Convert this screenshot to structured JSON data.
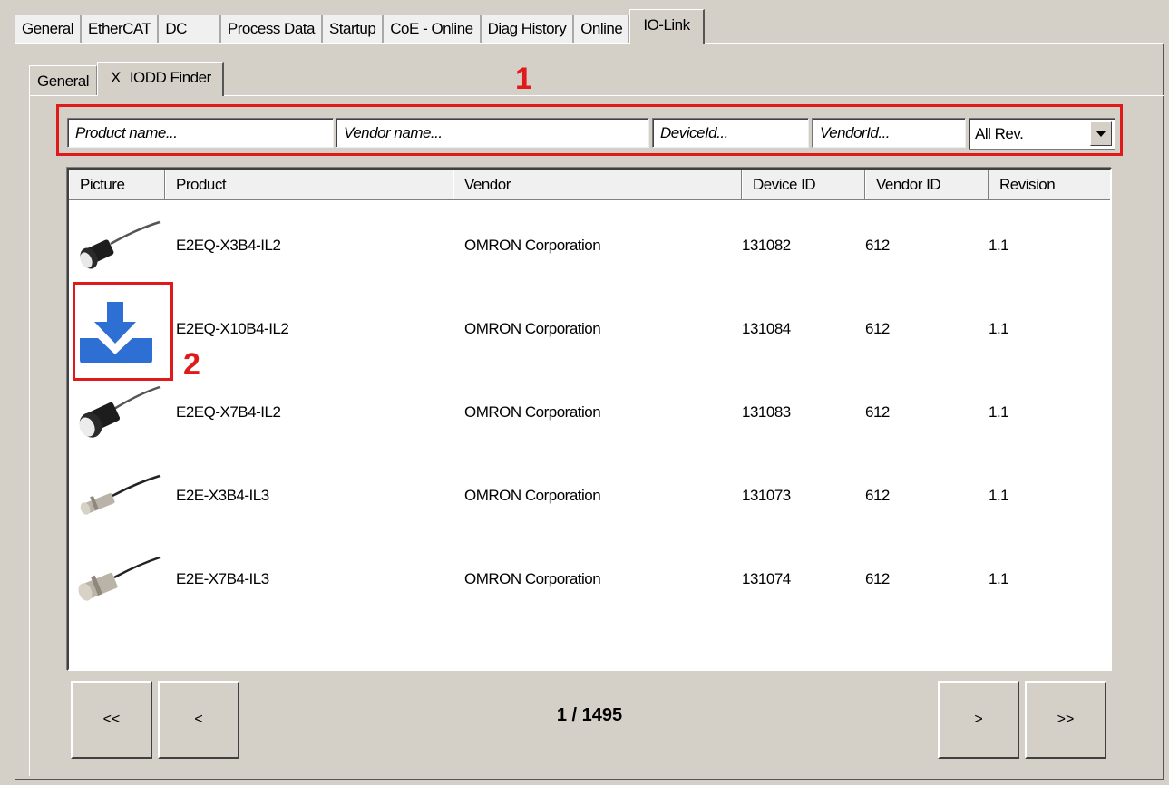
{
  "outer_tabs": [
    "General",
    "EtherCAT",
    "DC",
    "Process Data",
    "Startup",
    "CoE - Online",
    "Diag History",
    "Online",
    "IO-Link"
  ],
  "inner_tabs": {
    "general": "General",
    "close_glyph": "X",
    "iodd_finder": "IODD Finder"
  },
  "callouts": {
    "filter": "1",
    "download": "2"
  },
  "filters": {
    "product_placeholder": "Product name...",
    "vendor_placeholder": "Vendor name...",
    "device_placeholder": "DeviceId...",
    "vendorid_placeholder": "VendorId...",
    "revision_selected": "All Rev."
  },
  "columns": [
    "Picture",
    "Product",
    "Vendor",
    "Device ID",
    "Vendor ID",
    "Revision"
  ],
  "rows": [
    {
      "picture": "sensor-black-icon",
      "product": "E2EQ-X3B4-IL2",
      "vendor": "OMRON Corporation",
      "device_id": "131082",
      "vendor_id": "612",
      "revision": "1.1"
    },
    {
      "picture": "download-icon",
      "product": "E2EQ-X10B4-IL2",
      "vendor": "OMRON Corporation",
      "device_id": "131084",
      "vendor_id": "612",
      "revision": "1.1"
    },
    {
      "picture": "sensor-black-icon",
      "product": "E2EQ-X7B4-IL2",
      "vendor": "OMRON Corporation",
      "device_id": "131083",
      "vendor_id": "612",
      "revision": "1.1"
    },
    {
      "picture": "sensor-metal-icon",
      "product": "E2E-X3B4-IL3",
      "vendor": "OMRON Corporation",
      "device_id": "131073",
      "vendor_id": "612",
      "revision": "1.1"
    },
    {
      "picture": "sensor-metal-icon",
      "product": "E2E-X7B4-IL3",
      "vendor": "OMRON Corporation",
      "device_id": "131074",
      "vendor_id": "612",
      "revision": "1.1"
    }
  ],
  "pager": {
    "first": "<<",
    "prev": "<",
    "indicator": "1 / 1495",
    "next": ">",
    "last": ">>"
  },
  "colors": {
    "annotation": "#e01a1a",
    "download_icon": "#2e6fd4"
  }
}
